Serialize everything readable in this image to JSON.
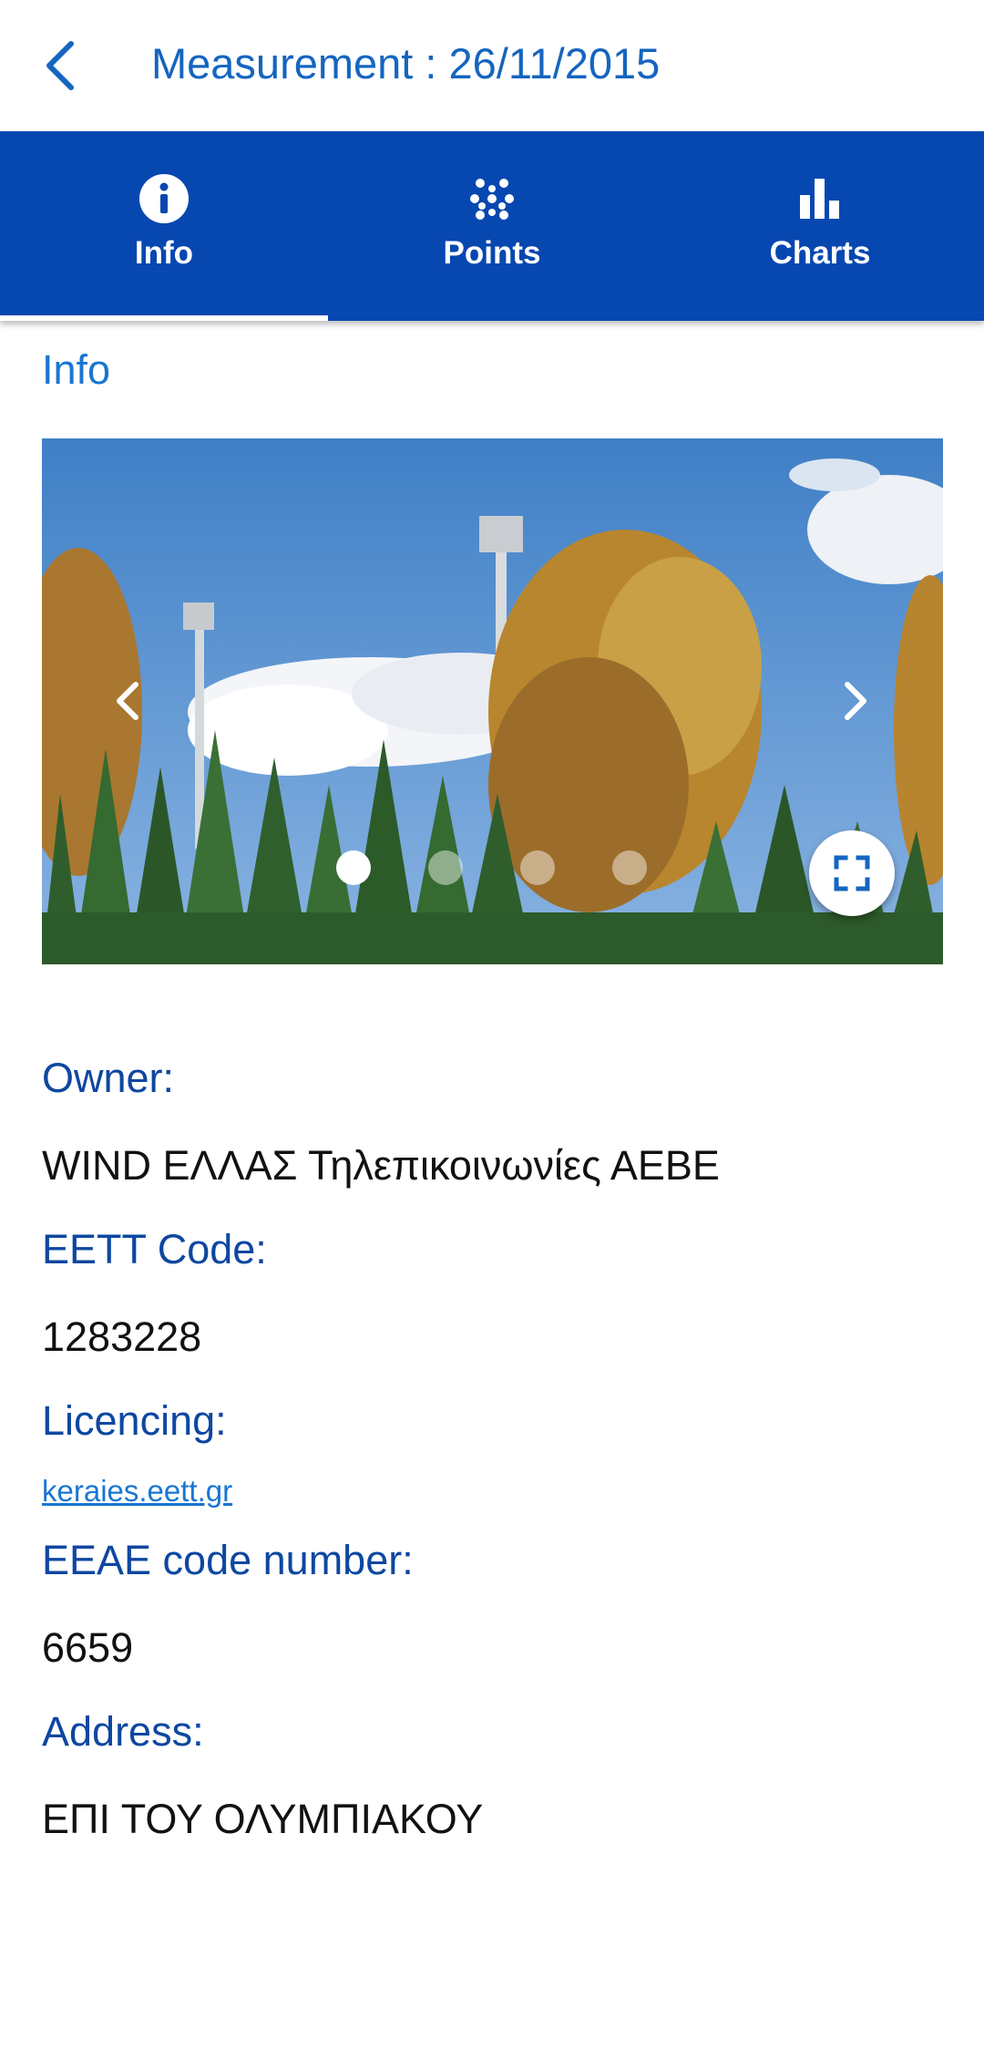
{
  "header": {
    "title": "Measurement : 26/11/2015",
    "back_icon": "chevron-left-icon"
  },
  "tabs": [
    {
      "label": "Info",
      "icon": "info-circle-icon",
      "selected": true
    },
    {
      "label": "Points",
      "icon": "dots-grid-icon",
      "selected": false
    },
    {
      "label": "Charts",
      "icon": "bar-chart-icon",
      "selected": false
    }
  ],
  "section": {
    "title": "Info"
  },
  "carousel": {
    "image": "photo of antenna masts behind cypress and autumn trees under blue sky",
    "slide_count": 4,
    "active_slide": 1,
    "prev_icon": "chevron-left-icon",
    "next_icon": "chevron-right-icon",
    "fullscreen_icon": "fullscreen-icon"
  },
  "info": {
    "owner_label": "Owner:",
    "owner_value": "WIND ΕΛΛΑΣ Τηλεπικοινωνίες ΑΕΒΕ",
    "eett_label": "EETT Code:",
    "eett_value": "1283228",
    "licencing_label": "Licencing:",
    "licencing_link": "keraies.eett.gr",
    "eeae_label": "EEAE code number:",
    "eeae_value": "6659",
    "address_label": "Address:",
    "address_value": "ΕΠΙ ΤΟΥ ΟΛΥΜΠΙΑΚΟΥ"
  },
  "colors": {
    "primary": "#0747b0",
    "accent": "#1976d2",
    "label": "#0d47a1"
  }
}
